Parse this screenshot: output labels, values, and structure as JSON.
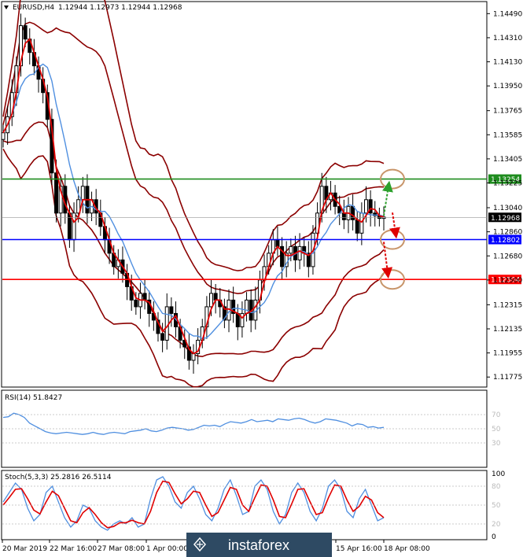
{
  "header": {
    "symbol_tf": "EURUSD,H4",
    "ohlc": "1.12944 1.12973 1.12944 1.12968",
    "rsi_label": "RSI(14) 51.8427",
    "stoch_label": "Stoch(5,3,3) 25.2816 26.5114"
  },
  "watermark": "instaforex",
  "chart_data": {
    "type": "candlestick",
    "symbol": "EURUSD",
    "timeframe": "H4",
    "price_axis": {
      "ticks": [
        "1.14490",
        "1.14310",
        "1.14130",
        "1.13950",
        "1.13765",
        "1.13585",
        "1.13405",
        "1.13225",
        "1.13040",
        "1.12860",
        "1.12680",
        "1.12500",
        "1.12315",
        "1.12135",
        "1.11955",
        "1.11775"
      ],
      "ylim": [
        1.117,
        1.1458
      ]
    },
    "time_axis": {
      "ticks": [
        "20 Mar 2019",
        "22 Mar 16:00",
        "27 Mar 08:00",
        "1 Apr 00:00",
        "15 Apr 16:00",
        "18 Apr 08:00"
      ]
    },
    "last_price": "1.12968",
    "levels": [
      {
        "value": 1.13254,
        "label": "1.13254",
        "color": "#1e8c1e"
      },
      {
        "value": 1.12802,
        "label": "1.12802",
        "color": "#0000ff"
      },
      {
        "value": 1.12504,
        "label": "1.12504",
        "color": "#ff0000"
      }
    ],
    "close_series": [
      1.136,
      1.1372,
      1.139,
      1.141,
      1.144,
      1.143,
      1.142,
      1.141,
      1.14,
      1.139,
      1.137,
      1.133,
      1.13,
      1.132,
      1.13,
      1.128,
      1.13,
      1.131,
      1.132,
      1.13,
      1.131,
      1.13,
      1.129,
      1.128,
      1.127,
      1.126,
      1.1265,
      1.1255,
      1.1245,
      1.1235,
      1.123,
      1.124,
      1.1235,
      1.1225,
      1.122,
      1.121,
      1.1205,
      1.123,
      1.1225,
      1.1215,
      1.1205,
      1.12,
      1.119,
      1.1195,
      1.1205,
      1.1215,
      1.123,
      1.124,
      1.1235,
      1.123,
      1.122,
      1.1235,
      1.1225,
      1.1215,
      1.1225,
      1.1235,
      1.122,
      1.1235,
      1.125,
      1.126,
      1.127,
      1.128,
      1.1275,
      1.126,
      1.127,
      1.1275,
      1.1265,
      1.1275,
      1.127,
      1.126,
      1.1285,
      1.13,
      1.132,
      1.131,
      1.1315,
      1.1305,
      1.13,
      1.1295,
      1.1305,
      1.1295,
      1.1285,
      1.13,
      1.131,
      1.13,
      1.1298,
      1.1296,
      1.1297
    ],
    "rsi": {
      "label": "RSI(14) 51.8427",
      "levels": [
        70,
        50,
        30
      ],
      "ylim": [
        0,
        100
      ],
      "values": [
        66,
        67,
        72,
        70,
        66,
        58,
        54,
        50,
        46,
        44,
        43,
        44,
        45,
        44,
        43,
        42,
        43,
        45,
        43,
        42,
        44,
        45,
        44,
        43,
        46,
        47,
        48,
        50,
        47,
        46,
        48,
        51,
        52,
        51,
        50,
        48,
        49,
        52,
        55,
        54,
        55,
        53,
        57,
        60,
        59,
        58,
        60,
        63,
        60,
        61,
        62,
        60,
        64,
        63,
        62,
        64,
        65,
        63,
        60,
        58,
        60,
        64,
        63,
        62,
        60,
        58,
        54,
        57,
        56,
        52,
        53,
        51,
        52
      ]
    },
    "stochastic": {
      "label": "Stoch(5,3,3) 25.2816 26.5114",
      "levels": [
        80,
        50,
        20
      ],
      "ylim": [
        0,
        100
      ],
      "main": [
        55,
        70,
        85,
        75,
        45,
        25,
        35,
        70,
        80,
        55,
        30,
        15,
        25,
        50,
        45,
        25,
        15,
        10,
        20,
        25,
        20,
        30,
        15,
        20,
        60,
        90,
        95,
        80,
        55,
        45,
        70,
        80,
        60,
        35,
        25,
        45,
        75,
        90,
        65,
        35,
        40,
        80,
        90,
        75,
        40,
        20,
        35,
        70,
        85,
        70,
        40,
        25,
        45,
        80,
        90,
        75,
        40,
        30,
        60,
        75,
        50,
        25,
        30
      ],
      "signal": [
        50,
        62,
        75,
        76,
        60,
        42,
        36,
        55,
        72,
        65,
        45,
        25,
        22,
        38,
        46,
        35,
        22,
        14,
        16,
        22,
        22,
        26,
        22,
        20,
        40,
        70,
        88,
        86,
        68,
        52,
        60,
        72,
        70,
        50,
        32,
        38,
        58,
        78,
        75,
        50,
        40,
        62,
        82,
        80,
        58,
        32,
        30,
        52,
        75,
        76,
        55,
        35,
        38,
        62,
        82,
        80,
        58,
        40,
        48,
        64,
        58,
        38,
        30
      ]
    }
  }
}
